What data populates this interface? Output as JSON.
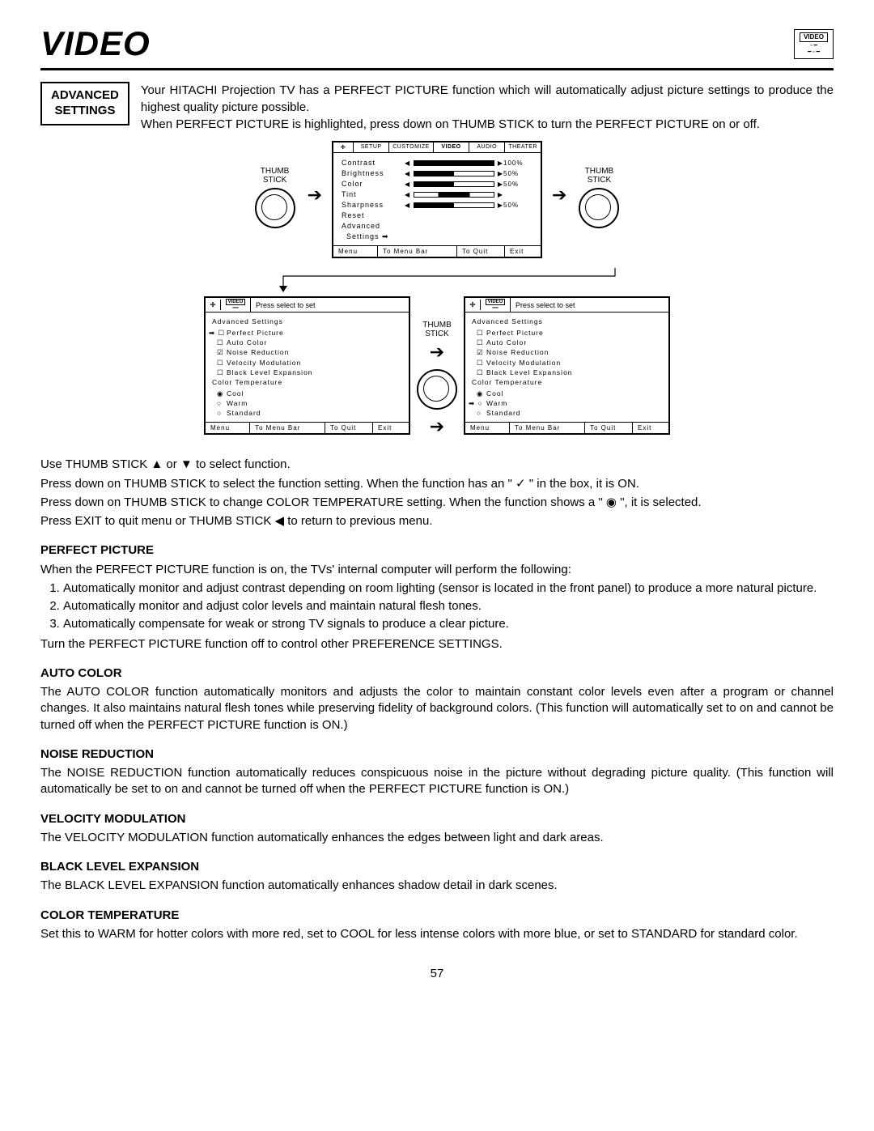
{
  "header": {
    "title": "VIDEO",
    "mini_box_title": "VIDEO"
  },
  "adv_box": {
    "line1": "ADVANCED",
    "line2": "SETTINGS"
  },
  "intro": "Your HITACHI Projection TV has a PERFECT PICTURE function which will automatically adjust picture settings to produce the highest quality picture possible.\nWhen PERFECT PICTURE is highlighted, press down on THUMB STICK to turn the PERFECT PICTURE on or off.",
  "diagram": {
    "thumb_stick_label": "THUMB\nSTICK",
    "top_osd": {
      "tabs": [
        "SETUP",
        "CUSTOMIZE",
        "VIDEO",
        "AUDIO",
        "THEATER"
      ],
      "rows": [
        {
          "label": "Contrast",
          "val": "100%"
        },
        {
          "label": "Brightness",
          "val": "50%"
        },
        {
          "label": "Color",
          "val": "50%"
        },
        {
          "label": "Tint",
          "val": ""
        },
        {
          "label": "Sharpness",
          "val": "50%"
        }
      ],
      "extra1": "Reset",
      "extra2": "Advanced",
      "extra3": "Settings   ➡",
      "footer": {
        "menu": "Menu",
        "bar": "To Menu Bar",
        "quit": "To Quit",
        "exit": "Exit"
      }
    },
    "press_select": "Press select to set",
    "adv_settings_heading": "Advanced Settings",
    "items_left": [
      {
        "mark": "➡ ☐",
        "label": "Perfect Picture"
      },
      {
        "mark": "☐",
        "label": "Auto Color"
      },
      {
        "mark": "☑",
        "label": "Noise Reduction"
      },
      {
        "mark": "☐",
        "label": "Velocity Modulation"
      },
      {
        "mark": "☐",
        "label": "Black Level Expansion"
      }
    ],
    "items_right": [
      {
        "mark": "☐",
        "label": "Perfect Picture"
      },
      {
        "mark": "☐",
        "label": "Auto Color"
      },
      {
        "mark": "☑",
        "label": "Noise Reduction"
      },
      {
        "mark": "☐",
        "label": "Velocity Modulation"
      },
      {
        "mark": "☐",
        "label": "Black Level Expansion"
      }
    ],
    "color_temp_heading": "Color Temperature",
    "temps_left": [
      {
        "mark": "◉",
        "label": "Cool"
      },
      {
        "mark": "○",
        "label": "Warm"
      },
      {
        "mark": "○",
        "label": "Standard"
      }
    ],
    "temps_right": [
      {
        "mark": "◉",
        "label": "Cool"
      },
      {
        "mark": "➡ ○",
        "label": "Warm"
      },
      {
        "mark": "○",
        "label": "Standard"
      }
    ]
  },
  "instructions": {
    "use_thumb": "Use THUMB STICK ▲ or ▼ to select function.",
    "press_select": "Press down on THUMB STICK to select the function setting. When the function has an \" ✓ \" in the box, it is ON.",
    "press_color": "Press down on THUMB STICK to change COLOR TEMPERATURE setting.  When the function shows a \" ◉ \", it is selected.",
    "press_exit": "Press EXIT to quit menu or THUMB STICK ◀ to return to previous menu."
  },
  "sections": {
    "perfect_picture": {
      "head": "PERFECT PICTURE",
      "intro": "When the PERFECT PICTURE function is on, the TVs' internal computer will perform the following:",
      "list": [
        "Automatically monitor and adjust contrast depending on room lighting (sensor is located in the front panel) to produce a more natural picture.",
        "Automatically monitor and adjust color levels and maintain natural flesh tones.",
        "Automatically compensate for weak or strong TV signals to produce a clear picture."
      ],
      "outro": "Turn the PERFECT PICTURE function off to control other PREFERENCE SETTINGS."
    },
    "auto_color": {
      "head": "AUTO COLOR",
      "body": "The AUTO COLOR function automatically monitors and adjusts the color to maintain constant color levels even after a program or channel changes. It also maintains natural flesh tones while preserving fidelity of background colors. (This function will automatically set to on and cannot be turned off when the PERFECT PICTURE function is ON.)"
    },
    "noise_reduction": {
      "head": "NOISE REDUCTION",
      "body": "The NOISE REDUCTION function automatically reduces conspicuous noise in the picture without degrading picture quality. (This function will automatically be set to on and cannot be turned off when the PERFECT PICTURE function is ON.)"
    },
    "velocity_modulation": {
      "head": "VELOCITY MODULATION",
      "body": "The VELOCITY MODULATION function automatically enhances the edges between light and dark areas."
    },
    "black_level": {
      "head": "BLACK LEVEL EXPANSION",
      "body": "The BLACK LEVEL EXPANSION function automatically enhances shadow detail in dark scenes."
    },
    "color_temperature": {
      "head": "COLOR TEMPERATURE",
      "body": "Set this to WARM for hotter colors with more red, set to COOL for less intense colors with more blue, or set to STANDARD for standard color."
    }
  },
  "page_number": "57"
}
